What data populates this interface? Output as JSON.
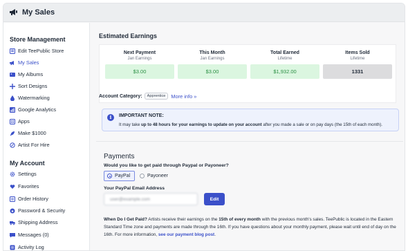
{
  "header": {
    "title": "My Sales",
    "icon": "megaphone-icon"
  },
  "sidebar": {
    "store_title": "Store Management",
    "store_items": [
      {
        "label": "Edit TeePublic Store",
        "icon": "store-icon"
      },
      {
        "label": "My Sales",
        "icon": "megaphone-icon",
        "active": true
      },
      {
        "label": "My Albums",
        "icon": "album-icon"
      },
      {
        "label": "Sort Designs",
        "icon": "move-icon"
      },
      {
        "label": "Watermarking",
        "icon": "drop-icon"
      },
      {
        "label": "Google Analytics",
        "icon": "chart-icon"
      },
      {
        "label": "Apps",
        "icon": "apps-icon"
      },
      {
        "label": "Make $1000",
        "icon": "rocket-icon"
      },
      {
        "label": "Artist For Hire",
        "icon": "brush-icon"
      }
    ],
    "account_title": "My Account",
    "account_items": [
      {
        "label": "Settings",
        "icon": "gear-icon"
      },
      {
        "label": "Favorites",
        "icon": "heart-icon"
      },
      {
        "label": "Order History",
        "icon": "history-icon"
      },
      {
        "label": "Password & Security",
        "icon": "lock-icon"
      },
      {
        "label": "Shipping Address",
        "icon": "truck-icon"
      },
      {
        "label": "Messages (0)",
        "icon": "message-icon"
      },
      {
        "label": "Activity Log",
        "icon": "log-icon"
      }
    ]
  },
  "earnings": {
    "title": "Estimated Earnings",
    "stats": [
      {
        "label": "Next Payment",
        "sub": "Jan Earnings",
        "value": "$3.00"
      },
      {
        "label": "This Month",
        "sub": "Jan Earnings",
        "value": "$3.00"
      },
      {
        "label": "Total Earned",
        "sub": "Lifetime",
        "value": "$1,932.00"
      },
      {
        "label": "Items Sold",
        "sub": "Lifetime",
        "value": "1331"
      }
    ]
  },
  "account_category": {
    "label": "Account Category:",
    "badge": "Apprentice",
    "more_info": "More info »"
  },
  "note": {
    "title": "IMPORTANT NOTE:",
    "prefix": "It may take ",
    "bold": "up to 48 hours for your earnings to update on your account",
    "suffix": " after you made a sale or on pay days (the 15th of each month)."
  },
  "payments": {
    "title": "Payments",
    "question": "Would you like to get paid through Paypal or Payoneer?",
    "options": [
      {
        "label": "PayPal",
        "selected": true
      },
      {
        "label": "Payoneer",
        "selected": false
      }
    ],
    "email_label": "Your PayPal Email Address",
    "email_value": "user@example.com",
    "edit_label": "Edit"
  },
  "when_paid": {
    "q": "When Do I Get Paid?",
    "t1": " Artists receive their earnings on the ",
    "b1": "15th of every month",
    "t2": " with the previous month's sales. TeePublic is located in the Eastern Standard Time zone and payments are made through the 16th. If you have questions about your monthly payment, please wait until end of day on the 16th. For more information, ",
    "link": "see our payment blog post",
    "t3": "."
  },
  "colors": {
    "accent": "#3b50c9",
    "green_bg": "#dbf6e0",
    "green_text": "#2a8f43",
    "note_bg": "#eef2fd"
  }
}
